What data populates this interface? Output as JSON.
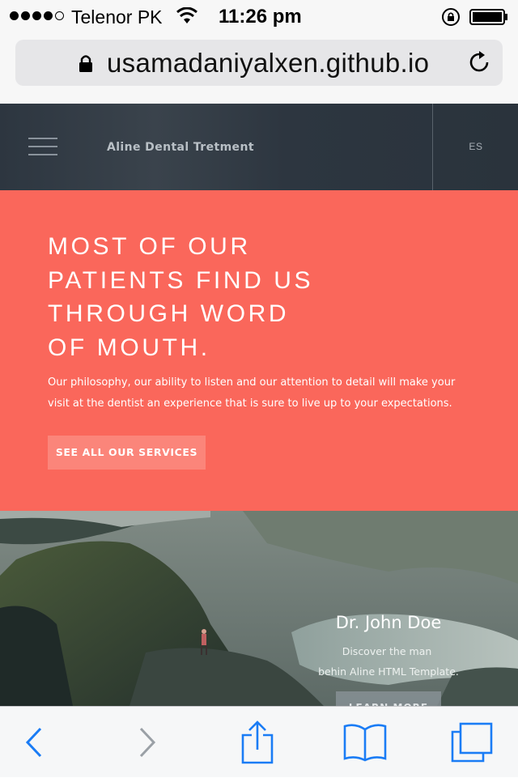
{
  "status_bar": {
    "carrier": "Telenor PK",
    "time": "11:26 pm"
  },
  "browser": {
    "url": "usamadaniyalxen.github.io"
  },
  "site_header": {
    "title": "Aline Dental Tretment",
    "language_label": "ES"
  },
  "hero": {
    "heading_lines": [
      "MOST OF OUR",
      "PATIENTS FIND US",
      "THROUGH WORD",
      "OF MOUTH."
    ],
    "body_line1": "Our philosophy, our ability to listen and our attention to detail will make your",
    "body_line2": "visit at the dentist an experience that is sure to live up to your expectations.",
    "button_label": "SEE ALL OUR SERVICES"
  },
  "profile": {
    "name": "Dr. John Doe",
    "subtitle_line1": "Discover the man",
    "subtitle_line2": "behin Aline HTML Template.",
    "button_label": "LEARN MORE"
  },
  "toolbar": {
    "icons": [
      "back-icon",
      "forward-icon",
      "share-icon",
      "bookmarks-icon",
      "tabs-icon"
    ]
  },
  "colors": {
    "hero_background": "#fa675b",
    "header_background": "#2d3640",
    "ios_blue": "#1a7cf5"
  }
}
